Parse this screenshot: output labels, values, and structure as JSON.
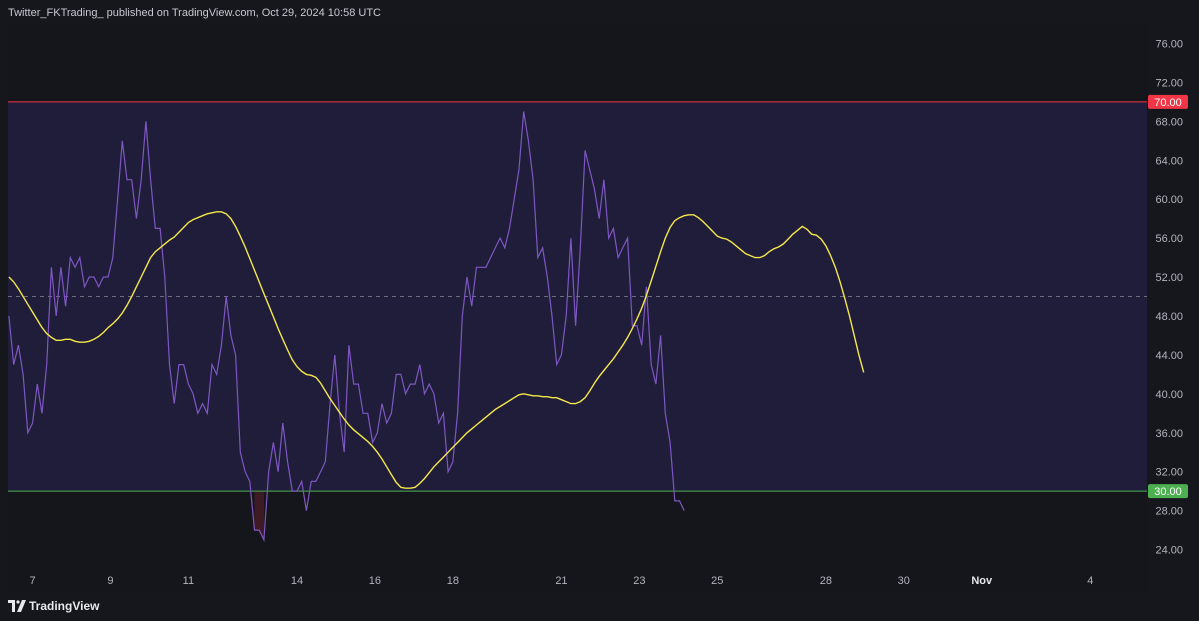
{
  "header": {
    "published": "Twitter_FKTrading_ published on TradingView.com, Oct 29, 2024 10:58 UTC"
  },
  "footer": {
    "brand": "TradingView",
    "brand_icon": "tradingview-logo-icon"
  },
  "colors": {
    "rsi": "#7e57c2",
    "ma": "#f5e84a",
    "upper": "#f23645",
    "lower": "#4caf50",
    "band": "#1f1d3a",
    "bg": "#15161c"
  },
  "chart_data": {
    "type": "line",
    "ylim": [
      22,
      78
    ],
    "y_ticks": [
      "76.00",
      "72.00",
      "68.00",
      "64.00",
      "60.00",
      "56.00",
      "52.00",
      "48.00",
      "44.00",
      "40.00",
      "36.00",
      "32.00",
      "28.00",
      "24.00"
    ],
    "x_ticks": [
      {
        "label": "7",
        "pos": 1
      },
      {
        "label": "9",
        "pos": 2.65
      },
      {
        "label": "11",
        "pos": 4.3
      },
      {
        "label": "14",
        "pos": 6.6
      },
      {
        "label": "16",
        "pos": 8.25
      },
      {
        "label": "18",
        "pos": 9.9
      },
      {
        "label": "21",
        "pos": 12.2
      },
      {
        "label": "23",
        "pos": 13.85
      },
      {
        "label": "25",
        "pos": 15.5
      },
      {
        "label": "28",
        "pos": 17.8
      },
      {
        "label": "30",
        "pos": 19.45
      },
      {
        "label": "Nov",
        "pos": 21.1
      },
      {
        "label": "4",
        "pos": 23.4
      }
    ],
    "levels": {
      "upper": 70,
      "middle": 50,
      "lower": 30,
      "upper_label": "70.00",
      "lower_label": "30.00"
    },
    "x_range": [
      0.48,
      24.6
    ],
    "rsi_x_start": 0.5,
    "rsi_step": 0.1,
    "series": [
      {
        "key": "rsi",
        "values": [
          48,
          43,
          45,
          42,
          36,
          37,
          41,
          38,
          43,
          53,
          48,
          53,
          49,
          54,
          53,
          54,
          51,
          52,
          52,
          51,
          52,
          52,
          54,
          60,
          66,
          62,
          62,
          58,
          62,
          68,
          62,
          57,
          57,
          52,
          43,
          39,
          43,
          43,
          41,
          40,
          38,
          39,
          38,
          43,
          42,
          45,
          50,
          46,
          44,
          34,
          32,
          31,
          26,
          26,
          25,
          32,
          35,
          32,
          37,
          33,
          30,
          30,
          31,
          28,
          31,
          31,
          32,
          33,
          39,
          44,
          38,
          34,
          45,
          41,
          41,
          38,
          38,
          35,
          36,
          39,
          37,
          38,
          42,
          42,
          40,
          41,
          41,
          43,
          40,
          41,
          40,
          37,
          38,
          32,
          33,
          38,
          48,
          52,
          49,
          53,
          53,
          53,
          54,
          55,
          56,
          55,
          57,
          60,
          63,
          69,
          66,
          62,
          54,
          55,
          52,
          48,
          43,
          44,
          48,
          56,
          47,
          55,
          65,
          63,
          61,
          58,
          62,
          56,
          57,
          54,
          55,
          56,
          47,
          47,
          45,
          51,
          43,
          41,
          46,
          38,
          35,
          29,
          29,
          28
        ]
      },
      {
        "key": "ma",
        "values": [
          52,
          51.5,
          50.8,
          50,
          49.2,
          48.4,
          47.6,
          46.8,
          46.2,
          45.8,
          45.5,
          45.5,
          45.6,
          45.6,
          45.4,
          45.3,
          45.3,
          45.4,
          45.6,
          45.9,
          46.3,
          46.8,
          47.2,
          47.7,
          48.3,
          49.1,
          50,
          51,
          52,
          53,
          54,
          54.6,
          55,
          55.4,
          55.8,
          56.1,
          56.6,
          57.1,
          57.6,
          57.9,
          58.1,
          58.3,
          58.5,
          58.6,
          58.7,
          58.7,
          58.5,
          58,
          57.2,
          56.2,
          55.1,
          53.9,
          52.7,
          51.5,
          50.3,
          49.1,
          47.9,
          46.7,
          45.6,
          44.5,
          43.5,
          42.8,
          42.3,
          42,
          41.9,
          41.7,
          41.1,
          40.3,
          39.5,
          38.8,
          38.1,
          37.4,
          36.8,
          36.3,
          35.9,
          35.5,
          35.1,
          34.6,
          34,
          33.3,
          32.5,
          31.7,
          30.9,
          30.4,
          30.3,
          30.3,
          30.4,
          30.8,
          31.3,
          31.9,
          32.5,
          33,
          33.5,
          34,
          34.5,
          35,
          35.5,
          36,
          36.4,
          36.8,
          37.2,
          37.6,
          38,
          38.4,
          38.7,
          39,
          39.3,
          39.6,
          39.9,
          40,
          39.9,
          39.8,
          39.8,
          39.7,
          39.7,
          39.6,
          39.6,
          39.4,
          39.2,
          39,
          39,
          39.2,
          39.6,
          40.3,
          41.1,
          41.8,
          42.4,
          43,
          43.6,
          44.3,
          45,
          45.8,
          46.7,
          47.7,
          48.8,
          50.1,
          51.6,
          53.1,
          54.6,
          56,
          57.1,
          57.8,
          58.1,
          58.3,
          58.4,
          58.4,
          58.1,
          57.7,
          57.2,
          56.7,
          56.2,
          56,
          55.9,
          55.6,
          55.2,
          54.8,
          54.4,
          54.2,
          54,
          54,
          54.2,
          54.6,
          54.9,
          55.1,
          55.4,
          55.9,
          56.4,
          56.8,
          57.2,
          56.9,
          56.4,
          56.3,
          55.9,
          55.2,
          54.2,
          53,
          51.5,
          49.8,
          48,
          46,
          44,
          42.2
        ]
      }
    ]
  }
}
